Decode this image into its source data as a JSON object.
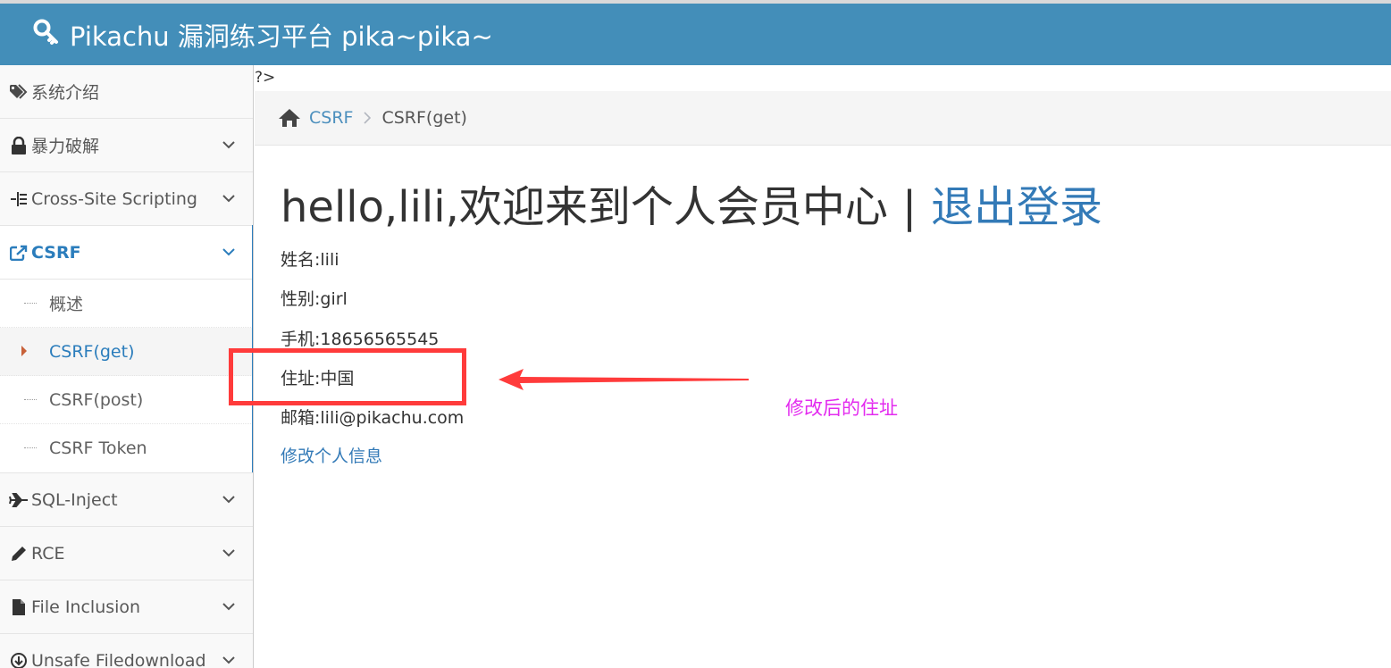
{
  "app": {
    "title": "Pikachu 漏洞练习平台 pika~pika~",
    "brand_icon": "key-icon",
    "accent_color": "#438eb9"
  },
  "sidebar": {
    "items": [
      {
        "label": "系统介绍",
        "icon": "tags-icon"
      },
      {
        "label": "暴力破解",
        "icon": "lock-icon"
      },
      {
        "label": "Cross-Site Scripting",
        "icon": "list-icon"
      },
      {
        "label": "CSRF",
        "icon": "share-icon",
        "active": true
      },
      {
        "label": "SQL-Inject",
        "icon": "plane-icon"
      },
      {
        "label": "RCE",
        "icon": "pencil-icon"
      },
      {
        "label": "File Inclusion",
        "icon": "file-icon"
      },
      {
        "label": "Unsafe Filedownload",
        "icon": "download-icon"
      }
    ],
    "csrf_submenu": [
      {
        "label": "概述"
      },
      {
        "label": "CSRF(get)",
        "current": true
      },
      {
        "label": "CSRF(post)"
      },
      {
        "label": "CSRF Token"
      }
    ]
  },
  "page": {
    "php_tail": "?>",
    "breadcrumb": {
      "home_icon": "home-icon",
      "parent": "CSRF",
      "current": "CSRF(get)"
    },
    "welcome_text": "hello,lili,欢迎来到个人会员中心",
    "welcome_separator": "|",
    "logout_label": "退出登录",
    "profile": {
      "name": "姓名:lili",
      "gender": "性别:girl",
      "phone": "手机:18656565545",
      "address": "住址:中国",
      "email": "邮箱:lili@pikachu.com"
    },
    "edit_link": "修改个人信息"
  },
  "annotation": {
    "text": "修改后的住址",
    "color": "#e32bef",
    "box_color": "#ff3b3b"
  }
}
